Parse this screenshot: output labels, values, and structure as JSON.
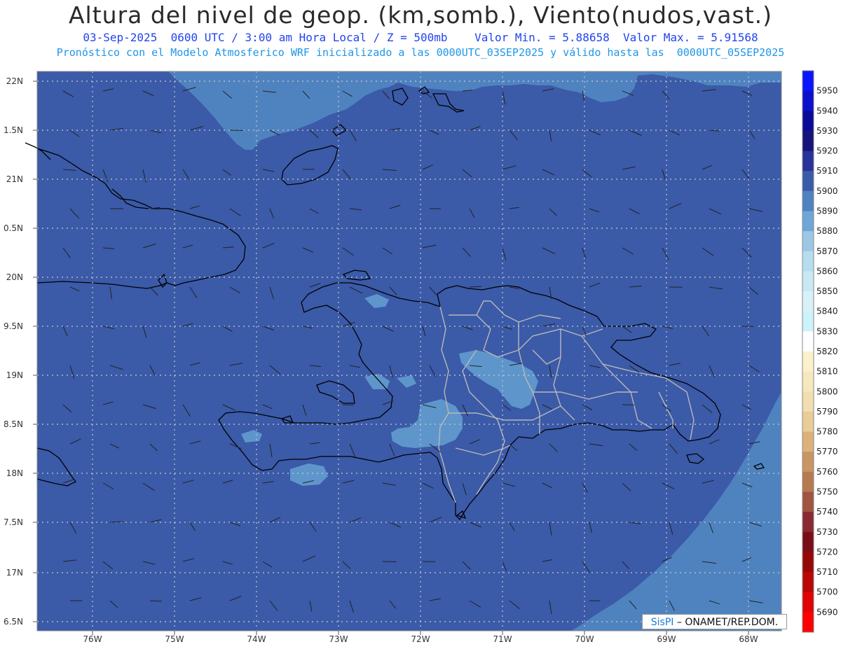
{
  "header": {
    "title": "Altura del nivel de geop. (km,somb.), Viento(nudos,vast.)",
    "date_line": "03-Sep-2025  0600 UTC / 3:00 am Hora Local / Z = 500mb    Valor Min. = 5.88658  Valor Max. = 5.91568",
    "model_line": "Pronóstico con el Modelo Atmosferico WRF inicializado a las 0000UTC_03SEP2025 y válido hasta las  0000UTC_05SEP2025"
  },
  "map": {
    "lat_labels": [
      "22N",
      "1.5N",
      "21N",
      "0.5N",
      "20N",
      "9.5N",
      "19N",
      "8.5N",
      "18N",
      "7.5N",
      "17N",
      "6.5N"
    ],
    "lon_labels": [
      "76W",
      "75W",
      "74W",
      "73W",
      "72W",
      "71W",
      "70W",
      "69W",
      "68W"
    ],
    "colors": {
      "shade_5900": "#3b5aa8",
      "shade_5890": "#4f83c0",
      "shade_5880": "#5e96cc",
      "coast": "#000000",
      "province_border": "#b8b8b8"
    }
  },
  "colorbar": {
    "levels": [
      {
        "label": "5950",
        "color": "#0a14ff"
      },
      {
        "label": "5940",
        "color": "#0a10cc"
      },
      {
        "label": "5930",
        "color": "#0a0a9a"
      },
      {
        "label": "5920",
        "color": "#16137a"
      },
      {
        "label": "5910",
        "color": "#28329a"
      },
      {
        "label": "5900",
        "color": "#3b5aa8"
      },
      {
        "label": "5890",
        "color": "#4f83c0"
      },
      {
        "label": "5880",
        "color": "#6ea6d6"
      },
      {
        "label": "5870",
        "color": "#9cc8e6"
      },
      {
        "label": "5860",
        "color": "#b6dcef"
      },
      {
        "label": "5850",
        "color": "#c8e8f4"
      },
      {
        "label": "5840",
        "color": "#d8f0f8"
      },
      {
        "label": "5830",
        "color": "#cdf3fa"
      },
      {
        "label": "5820",
        "color": "#ffffff"
      },
      {
        "label": "5810",
        "color": "#fbf2cc"
      },
      {
        "label": "5800",
        "color": "#f6e8bd"
      },
      {
        "label": "5790",
        "color": "#f1deb0"
      },
      {
        "label": "5780",
        "color": "#e9cc96"
      },
      {
        "label": "5770",
        "color": "#dcb27a"
      },
      {
        "label": "5760",
        "color": "#c99562"
      },
      {
        "label": "5750",
        "color": "#b67a50"
      },
      {
        "label": "5740",
        "color": "#a05540"
      },
      {
        "label": "5730",
        "color": "#8a2a30"
      },
      {
        "label": "5720",
        "color": "#7a0e18"
      },
      {
        "label": "5710",
        "color": "#960808"
      },
      {
        "label": "5700",
        "color": "#bb0606"
      },
      {
        "label": "5690",
        "color": "#e00404"
      },
      {
        "label": "",
        "color": "#ff0000"
      }
    ]
  },
  "credit": {
    "brand": "SisPI",
    "text": " ONAMET/REP.DOM."
  }
}
